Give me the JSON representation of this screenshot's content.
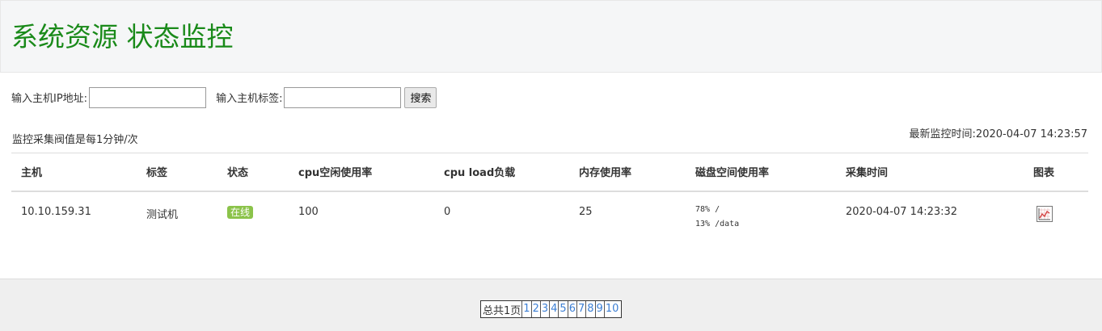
{
  "header": {
    "title": "系统资源 状态监控"
  },
  "search": {
    "ip_label": "输入主机IP地址:",
    "ip_value": "",
    "tag_label": "输入主机标签:",
    "tag_value": "",
    "button_label": "搜索"
  },
  "info": {
    "interval": "监控采集阀值是每1分钟/次",
    "latest": "最新监控时间:2020-04-07 14:23:57"
  },
  "table": {
    "headers": [
      "主机",
      "标签",
      "状态",
      "cpu空闲使用率",
      "cpu load负载",
      "内存使用率",
      "磁盘空间使用率",
      "采集时间",
      "图表"
    ],
    "rows": [
      {
        "host": "10.10.159.31",
        "tag": "测试机",
        "status": "在线",
        "cpu_idle": "100",
        "cpu_load": "0",
        "memory": "25",
        "disk_line1": "78% /",
        "disk_line2": "13% /data",
        "time": "2020-04-07 14:23:32",
        "chart_icon": "line-chart-icon"
      }
    ]
  },
  "pagination": {
    "total": "总共1页",
    "pages": [
      "1",
      "2",
      "3",
      "4",
      "5",
      "6",
      "7",
      "8",
      "9",
      "10"
    ]
  },
  "colors": {
    "title": "#1a8a1a",
    "badge": "#8bc34a",
    "link": "#3c7fd4"
  }
}
